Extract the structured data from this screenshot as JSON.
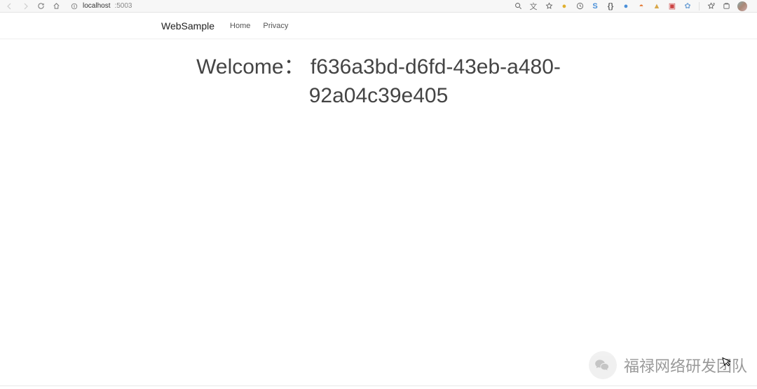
{
  "browser": {
    "address_host": "localhost",
    "address_port": ":5003"
  },
  "navbar": {
    "brand": "WebSample",
    "links": {
      "home": "Home",
      "privacy": "Privacy"
    }
  },
  "main": {
    "welcome_text": "Welcome： f636a3bd-d6fd-43eb-a480-92a04c39e405"
  },
  "watermark": {
    "text": "福禄网络研发团队"
  }
}
